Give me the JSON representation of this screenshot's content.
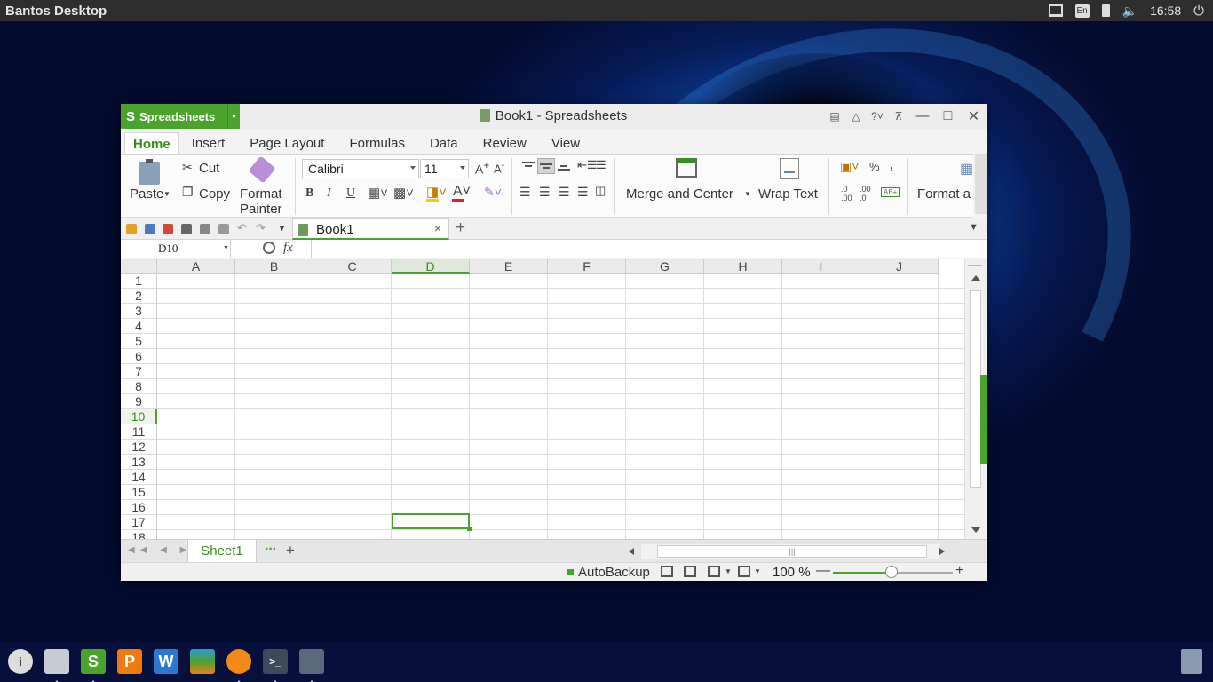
{
  "desktop": {
    "panel_title": "Bantos Desktop",
    "lang": "En",
    "clock": "16:58"
  },
  "window": {
    "app_menu_label": "Spreadsheets",
    "title": "Book1 - Spreadsheets",
    "tabs": [
      "Home",
      "Insert",
      "Page Layout",
      "Formulas",
      "Data",
      "Review",
      "View"
    ],
    "active_tab": "Home"
  },
  "ribbon": {
    "paste": "Paste",
    "cut": "Cut",
    "copy": "Copy",
    "format_painter_1": "Format",
    "format_painter_2": "Painter",
    "font_name": "Calibri",
    "font_size": "11",
    "merge": "Merge and Center",
    "wrap": "Wrap Text",
    "format_as": "Format a",
    "bold": "B",
    "italic": "I",
    "underline": "U",
    "percent": "%",
    "comma": ","
  },
  "doc_tab": {
    "label": "Book1"
  },
  "formula_bar": {
    "cell_ref": "D10",
    "fx": "fx",
    "value": ""
  },
  "sheet": {
    "columns": [
      "A",
      "B",
      "C",
      "D",
      "E",
      "F",
      "G",
      "H",
      "I",
      "J"
    ],
    "rows": [
      "1",
      "2",
      "3",
      "4",
      "5",
      "6",
      "7",
      "8",
      "9",
      "10",
      "11",
      "12",
      "13",
      "14",
      "15",
      "16",
      "17",
      "18"
    ],
    "selected_col": "D",
    "selected_row": "10"
  },
  "sheet_tabs": {
    "active": "Sheet1",
    "more": "···",
    "add": "+"
  },
  "status": {
    "autobackup": "AutoBackup",
    "zoom": "100 %",
    "zoom_fraction": 0.5
  },
  "colors": {
    "accent": "#4aa32c"
  }
}
